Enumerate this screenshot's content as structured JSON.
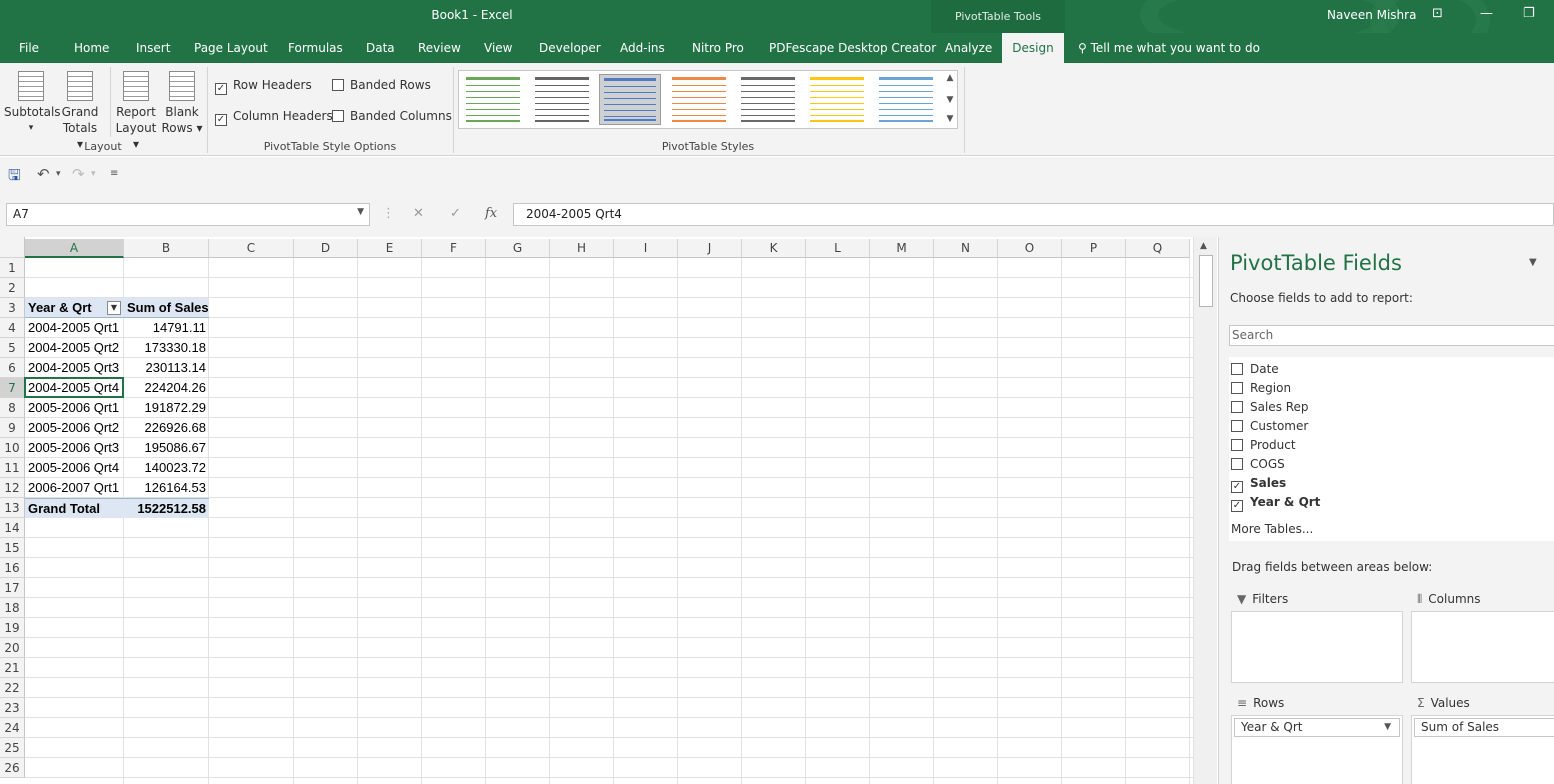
{
  "window": {
    "title": "Book1  -  Excel",
    "context_tab_group": "PivotTable Tools",
    "user": "Naveen Mishra"
  },
  "tabs": [
    "File",
    "Home",
    "Insert",
    "Page Layout",
    "Formulas",
    "Data",
    "Review",
    "View",
    "Developer",
    "Add-ins",
    "Nitro Pro",
    "PDFescape Desktop Creator",
    "Analyze",
    "Design"
  ],
  "active_tab": "Design",
  "tell_me": "Tell me what you want to do",
  "ribbon": {
    "layout_buttons": [
      {
        "line1": "Subtotals",
        "line2": "▾"
      },
      {
        "line1": "Grand",
        "line2": "Totals ▾"
      },
      {
        "line1": "Report",
        "line2": "Layout ▾"
      },
      {
        "line1": "Blank",
        "line2": "Rows ▾"
      }
    ],
    "layout_label": "Layout",
    "options": [
      {
        "label": "Row Headers",
        "checked": true
      },
      {
        "label": "Column Headers",
        "checked": true
      },
      {
        "label": "Banded Rows",
        "checked": false
      },
      {
        "label": "Banded Columns",
        "checked": false
      }
    ],
    "options_label": "PivotTable Style Options",
    "styles_label": "PivotTable Styles",
    "style_colors": [
      "#5b9e46",
      "#555555",
      "#4472c4",
      "#ed7d31",
      "#595959",
      "#ffc000",
      "#5b9bd5"
    ],
    "selected_style_index": 2
  },
  "formula_bar": {
    "name_box": "A7",
    "cancel_icon": "✕",
    "enter_icon": "✓",
    "fx_label": "fx",
    "value": "2004-2005 Qrt4"
  },
  "sheet": {
    "columns": [
      "A",
      "B",
      "C",
      "D",
      "E",
      "F",
      "G",
      "H",
      "I",
      "J",
      "K",
      "L",
      "M",
      "N",
      "O",
      "P",
      "Q"
    ],
    "rows": [
      "1",
      "2",
      "3",
      "4",
      "5",
      "6",
      "7",
      "8",
      "9",
      "10",
      "11",
      "12",
      "13",
      "14",
      "15",
      "16",
      "17",
      "18",
      "19",
      "20",
      "21",
      "22",
      "23",
      "24",
      "25",
      "26"
    ],
    "selected_column": "A",
    "selected_row": "7",
    "pivot": {
      "header": [
        "Year & Qrt",
        "Sum of Sales"
      ],
      "rows": [
        [
          "2004-2005 Qrt1",
          "14791.11"
        ],
        [
          "2004-2005 Qrt2",
          "173330.18"
        ],
        [
          "2004-2005 Qrt3",
          "230113.14"
        ],
        [
          "2004-2005 Qrt4",
          "224204.26"
        ],
        [
          "2005-2006 Qrt1",
          "191872.29"
        ],
        [
          "2005-2006 Qrt2",
          "226926.68"
        ],
        [
          "2005-2006 Qrt3",
          "195086.67"
        ],
        [
          "2005-2006 Qrt4",
          "140023.72"
        ],
        [
          "2006-2007 Qrt1",
          "126164.53"
        ]
      ],
      "total": [
        "Grand Total",
        "1522512.58"
      ]
    }
  },
  "pivot_pane": {
    "title": "PivotTable Fields",
    "choose": "Choose fields to add to report:",
    "search_placeholder": "Search",
    "fields": [
      {
        "name": "Date",
        "checked": false
      },
      {
        "name": "Region",
        "checked": false
      },
      {
        "name": "Sales Rep",
        "checked": false
      },
      {
        "name": "Customer",
        "checked": false
      },
      {
        "name": "Product",
        "checked": false
      },
      {
        "name": "COGS",
        "checked": false
      },
      {
        "name": "Sales",
        "checked": true
      },
      {
        "name": "Year & Qrt",
        "checked": true
      }
    ],
    "more_tables": "More Tables...",
    "drag_label": "Drag fields between areas below:",
    "areas": {
      "filters": "Filters",
      "columns": "Columns",
      "rows": "Rows",
      "values": "Values",
      "rows_item": "Year & Qrt",
      "values_item": "Sum of Sales"
    }
  },
  "colors": {
    "accent": "#217346",
    "pivot_header": "#dde6f3"
  }
}
